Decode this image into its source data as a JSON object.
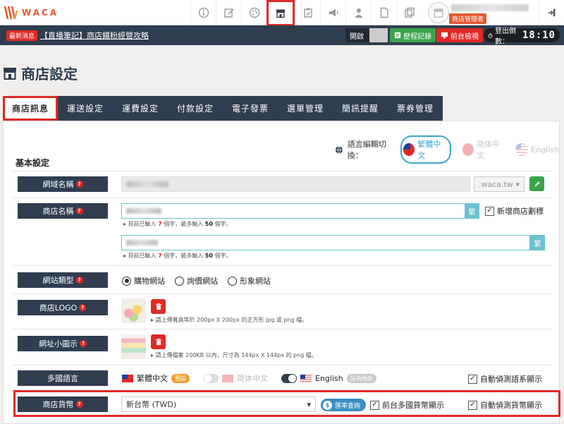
{
  "brand": {
    "name": "WACA"
  },
  "topnav": {
    "icons": [
      "info-icon",
      "edit-icon",
      "palette-icon",
      "store-icon",
      "clipboard-icon",
      "megaphone-icon",
      "user-icon",
      "document-icon",
      "copy-icon"
    ],
    "active": "store-icon",
    "role_badge": "商店管理者"
  },
  "newsbar": {
    "tag": "最新消息",
    "link": "【直播筆記】商店鐵粉經營攻略",
    "open_label": "開啟",
    "history_label": "歷程記錄",
    "front_label": "前台檢視",
    "countdown_label": "登出倒數：",
    "countdown_time": "18:10"
  },
  "page": {
    "title": "商店設定"
  },
  "tabs": [
    "商店訊息",
    "運送設定",
    "運費設定",
    "付款設定",
    "電子發票",
    "選單管理",
    "簡訊提醒",
    "票券管理"
  ],
  "lang_switch": {
    "label": "語言編輯切換：",
    "options": [
      "繁體中文",
      "简体中文",
      "English"
    ],
    "active": "繁體中文"
  },
  "basic": {
    "section_title": "基本設定",
    "domain": {
      "label": "網域名稱",
      "suffix": ".waca.tw"
    },
    "store_name": {
      "label": "商店名稱",
      "suffix": "繁",
      "checkbox": "新增商店劃標",
      "hint1": {
        "pre": "目前已輸入 ",
        "count": "7",
        "mid": " 個字，最多輸入 ",
        "max": "50",
        "post": " 個字。"
      },
      "hint2": {
        "pre": "目前已輸入 ",
        "count": "7",
        "mid": " 個字，最多輸入 ",
        "max": "50",
        "post": " 個字。"
      }
    },
    "site_type": {
      "label": "網站類型",
      "options": [
        "購物網站",
        "詢價網站",
        "形象網站"
      ],
      "selected": "購物網站"
    },
    "logo": {
      "label": "商店LOGO",
      "hint": "請上傳寬高等於 200px X 200px 的正方形 jpg 或 png 檔。"
    },
    "favicon": {
      "label": "網址小圖示",
      "hint": "請上傳檔案 200KB 以內，尺寸為 144px X 144px 的 png 檔。"
    },
    "multi_lang": {
      "label": "多國語言",
      "langs": [
        {
          "name": "繁體中文",
          "badge": "預設"
        },
        {
          "name": "简体中文",
          "badge": ""
        },
        {
          "name": "English",
          "badge": "設為預設"
        }
      ],
      "auto_detect": "自動偵測語系顯示"
    },
    "currency": {
      "label": "商店貨幣",
      "value": "新台幣 (TWD)",
      "rate_button": "匯率查詢",
      "front_multi": "前台多國貨幣顯示",
      "auto_detect": "自動偵測貨幣顯示"
    }
  }
}
